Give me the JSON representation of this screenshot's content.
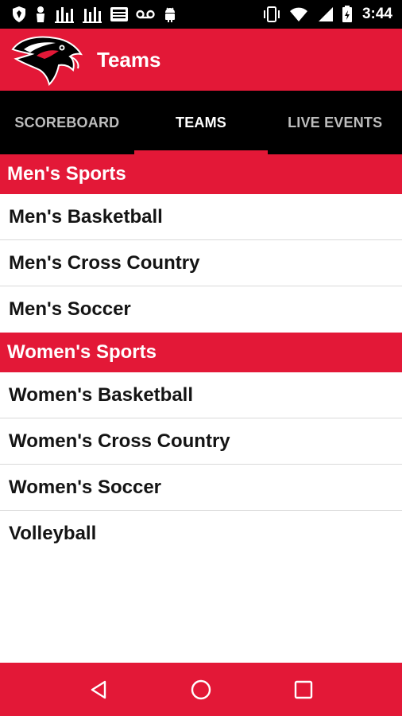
{
  "status_bar": {
    "time": "3:44",
    "left_icons": [
      "shield-icon",
      "person-icon",
      "stats-icon",
      "stats-icon-2",
      "news-icon",
      "voicemail-icon",
      "android-icon"
    ],
    "right_icons": [
      "vibrate-icon",
      "wifi-icon",
      "signal-icon",
      "battery-icon"
    ]
  },
  "app_bar": {
    "title": "Teams",
    "logo_icon": "hawk-logo"
  },
  "tabs": [
    {
      "label": "SCOREBOARD",
      "active": false
    },
    {
      "label": "TEAMS",
      "active": true
    },
    {
      "label": "LIVE EVENTS",
      "active": false
    }
  ],
  "sections": [
    {
      "header": "Men's Sports",
      "items": [
        "Men's Basketball",
        "Men's Cross Country",
        "Men's Soccer"
      ]
    },
    {
      "header": "Women's Sports",
      "items": [
        "Women's Basketball",
        "Women's Cross Country",
        "Women's Soccer",
        "Volleyball"
      ]
    }
  ],
  "nav_bar": {
    "buttons": [
      "back-icon",
      "home-icon",
      "recents-icon"
    ]
  },
  "colors": {
    "brand_red": "#e31837",
    "black": "#000000",
    "white": "#ffffff"
  }
}
